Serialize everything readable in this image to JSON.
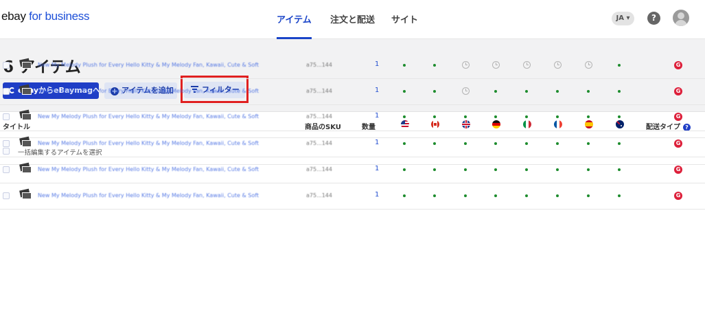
{
  "brand": {
    "part1": "ebay",
    "part2": " for business"
  },
  "nav": {
    "tabs": [
      {
        "label": "アイテム",
        "active": true
      },
      {
        "label": "注文と配送",
        "active": false
      },
      {
        "label": "サイト",
        "active": false
      }
    ],
    "language": "JA ▾",
    "help_icon": "?"
  },
  "page": {
    "title": "6 アイテム"
  },
  "toolbar": {
    "primary_button": "eBayからeBaymagへ",
    "add_item_button": "アイテムを追加",
    "filter_button": "フィルター",
    "highlight_color": "#e02020"
  },
  "table": {
    "columns": {
      "title": "タイトル",
      "sku": "商品のSKU",
      "quantity": "数量",
      "flags": [
        "us-flag-icon",
        "ca-flag-icon",
        "uk-flag-icon",
        "de-flag-icon",
        "it-flag-icon",
        "fr-flag-icon",
        "es-flag-icon",
        "au-flag-icon"
      ],
      "shipping_type": "配送タイプ"
    },
    "select_all_label": "一括編集するアイテムを選択",
    "rows": [
      {
        "title": "New My Melody Plush for Every Hello Kitty & My Melody Fan, Kawaii, Cute & Soft",
        "sku": "a75...144",
        "quantity": "1",
        "status": [
          "dot",
          "dot",
          "clock",
          "clock",
          "clock",
          "clock",
          "clock",
          "dot"
        ],
        "shipping_badge": "G"
      },
      {
        "title": "New My Melody Plush for Every Hello Kitty & My Melody Fan, Kawaii, Cute & Soft",
        "sku": "a75...144",
        "quantity": "1",
        "status": [
          "dot",
          "dot",
          "clock",
          "dot",
          "dot",
          "dot",
          "dot",
          "dot"
        ],
        "shipping_badge": "G"
      },
      {
        "title": "New My Melody Plush for Every Hello Kitty & My Melody Fan, Kawaii, Cute & Soft",
        "sku": "a75...144",
        "quantity": "1",
        "status": [
          "dot",
          "dot",
          "dot",
          "dot",
          "dot",
          "dot",
          "dot",
          "dot"
        ],
        "shipping_badge": "G"
      },
      {
        "title": "New My Melody Plush for Every Hello Kitty & My Melody Fan, Kawaii, Cute & Soft",
        "sku": "a75...144",
        "quantity": "1",
        "status": [
          "dot",
          "dot",
          "dot",
          "dot",
          "dot",
          "dot",
          "dot",
          "dot"
        ],
        "shipping_badge": "G"
      },
      {
        "title": "New My Melody Plush for Every Hello Kitty & My Melody Fan, Kawaii, Cute & Soft",
        "sku": "a75...144",
        "quantity": "1",
        "status": [
          "dot",
          "dot",
          "dot",
          "dot",
          "dot",
          "dot",
          "dot",
          "dot"
        ],
        "shipping_badge": "G"
      },
      {
        "title": "New My Melody Plush for Every Hello Kitty & My Melody Fan, Kawaii, Cute & Soft",
        "sku": "a75...144",
        "quantity": "1",
        "status": [
          "dot",
          "dot",
          "dot",
          "dot",
          "dot",
          "dot",
          "dot",
          "dot"
        ],
        "shipping_badge": "G"
      }
    ]
  },
  "colors": {
    "accent": "#1a44c8",
    "available_dot": "#1d8c2d",
    "badge_red": "#dd1f3a"
  }
}
